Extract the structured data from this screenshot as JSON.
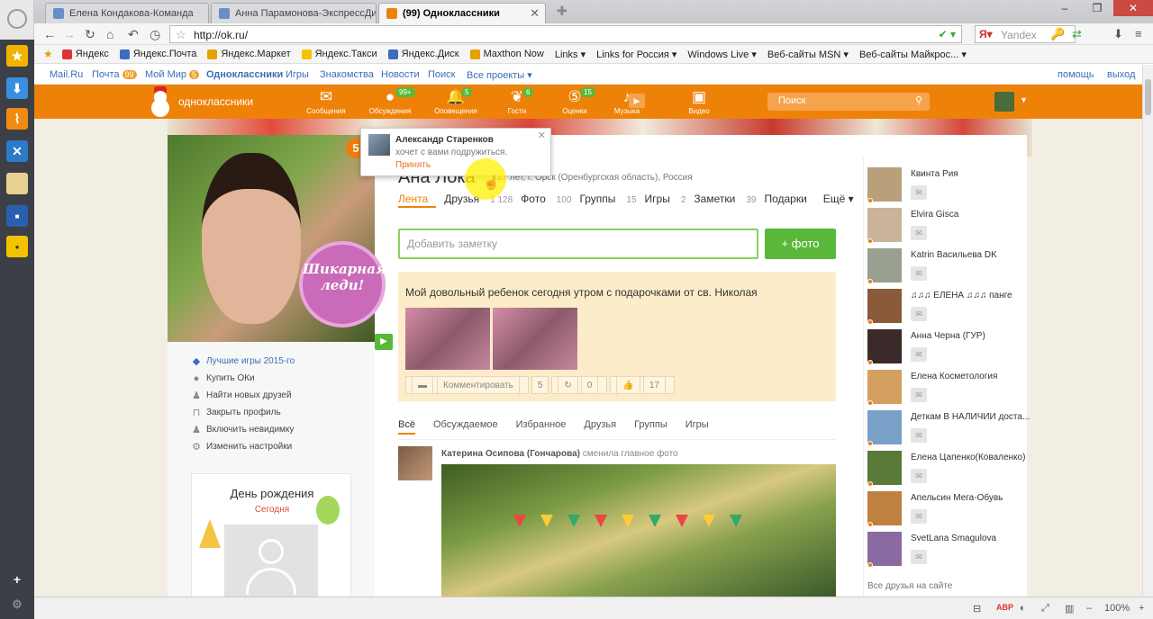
{
  "browser": {
    "tabs": [
      {
        "label": "Елена Кондакова-Команда",
        "favicon_color": "#6a8cc7"
      },
      {
        "label": "Анна Парамонова-ЭкспрессДи...",
        "favicon_color": "#6a8cc7"
      },
      {
        "label": "(99) Одноклассники",
        "favicon_color": "#ee8208"
      }
    ],
    "url": "http://ok.ru/",
    "search_placeholder": "Yandex",
    "zoom": "100%",
    "bookmarks": [
      {
        "label": "Яндекс",
        "color": "#d33"
      },
      {
        "label": "Яндекс.Почта",
        "color": "#3a6cc0"
      },
      {
        "label": "Яндекс.Маркет",
        "color": "#e5a100"
      },
      {
        "label": "Яндекс.Такси",
        "color": "#f3c300"
      },
      {
        "label": "Яндекс.Диск",
        "color": "#3a6cc0"
      },
      {
        "label": "Maxthon Now",
        "color": "#e5a100"
      },
      {
        "label": "Links ▾",
        "color": ""
      },
      {
        "label": "Links for Россия ▾",
        "color": ""
      },
      {
        "label": "Windows Live ▾",
        "color": ""
      },
      {
        "label": "Веб-сайты MSN ▾",
        "color": ""
      },
      {
        "label": "Веб-сайты Майкрос... ▾",
        "color": ""
      }
    ]
  },
  "ok_links": {
    "mailru": "Mail.Ru",
    "pochta": "Почта",
    "pochta_count": "99",
    "moi_mir": "Мой Мир",
    "moi_mir_count": "5",
    "ok": "Одноклассники",
    "igry": "Игры",
    "znakomstva": "Знакомства",
    "novosti": "Новости",
    "poisk": "Поиск",
    "vse": "Все проекты ▾",
    "help": "помощь",
    "exit": "выход"
  },
  "okbar": {
    "logo": "одноклассники",
    "nav": [
      {
        "label": "Сообщения",
        "icon": "envelope-icon",
        "glyph": "✉",
        "badge": ""
      },
      {
        "label": "Обсуждения",
        "icon": "chat-icon",
        "glyph": "💬",
        "badge": "99+"
      },
      {
        "label": "Оповещения",
        "icon": "bell-icon",
        "glyph": "🔔",
        "badge": "5"
      },
      {
        "label": "Гости",
        "icon": "footprints-icon",
        "glyph": "👣",
        "badge": "6"
      },
      {
        "label": "Оценки",
        "icon": "rating-icon",
        "glyph": "⑤",
        "badge": "15"
      },
      {
        "label": "Музыка",
        "icon": "music-icon",
        "glyph": "♪",
        "badge": ""
      },
      {
        "label": "Видео",
        "icon": "video-icon",
        "glyph": "🎥",
        "badge": ""
      }
    ],
    "search_placeholder": "Поиск"
  },
  "profile": {
    "name": "Ана Лока",
    "info": "27 лет, г. Орск (Оренбургская область), Россия",
    "avatar_badge_count": "5",
    "avatar_badge_text": "Шикарная леди!",
    "tabs": [
      {
        "label": "Лента",
        "count": ""
      },
      {
        "label": "Друзья",
        "count": "1 128"
      },
      {
        "label": "Фото",
        "count": "100"
      },
      {
        "label": "Группы",
        "count": "15"
      },
      {
        "label": "Игры",
        "count": "2"
      },
      {
        "label": "Заметки",
        "count": "39"
      },
      {
        "label": "Подарки",
        "count": ""
      },
      {
        "label": "Ещё ▾",
        "count": ""
      }
    ],
    "note_placeholder": "Добавить заметку",
    "photo_button": "+ фото"
  },
  "left_menu": [
    {
      "label": "Лучшие игры 2015-го",
      "icon": "gamepad-icon",
      "glyph": "🎮"
    },
    {
      "label": "Купить ОКи",
      "icon": "coin-icon",
      "glyph": "●"
    },
    {
      "label": "Найти новых друзей",
      "icon": "person-icon",
      "glyph": "👤"
    },
    {
      "label": "Закрыть профиль",
      "icon": "lock-icon",
      "glyph": "🔓"
    },
    {
      "label": "Включить невидимку",
      "icon": "invisible-icon",
      "glyph": "👤"
    },
    {
      "label": "Изменить настройки",
      "icon": "gear-icon",
      "glyph": "⚙"
    }
  ],
  "birthday": {
    "title": "День рождения",
    "subtitle": "Сегодня"
  },
  "post1": {
    "text": "Мой довольный ребенок сегодня утром с подарочками от св. Николая",
    "comment": "Комментировать",
    "comment_count": "5",
    "share_count": "0",
    "like_count": "17"
  },
  "feed_tabs": [
    "Всё",
    "Обсуждаемое",
    "Избранное",
    "Друзья",
    "Группы",
    "Игры"
  ],
  "post2": {
    "author": "Катерина Осипова (Гончарова)",
    "action": "сменила главное фото"
  },
  "friends": [
    {
      "name": "Квинта Рия",
      "color": "#b8a07a"
    },
    {
      "name": "Elvira Gisca",
      "color": "#c9b39a"
    },
    {
      "name": "Katrin Васильева DK",
      "color": "#9aa090"
    },
    {
      "name": "♫♫♫ ЕЛЕНА ♫♫♫ панге",
      "color": "#8a5a3a"
    },
    {
      "name": "Анна Черна (ГУР)",
      "color": "#3a2a2a"
    },
    {
      "name": "Елена Косметология",
      "color": "#d4a060"
    },
    {
      "name": "Деткам В НАЛИЧИИ доста...",
      "color": "#7aa0c8"
    },
    {
      "name": "Елена Цапенко(Коваленко)",
      "color": "#5a7a3a"
    },
    {
      "name": "Апельсин Мега-Обувь",
      "color": "#c08040"
    },
    {
      "name": "SvetLana Smagulova",
      "color": "#8a6aa0"
    }
  ],
  "all_friends": "Все друзья на сайте",
  "popup": {
    "name": "Александр Старенков",
    "text": "хочет с вами подружиться.",
    "accept": "Принять"
  }
}
